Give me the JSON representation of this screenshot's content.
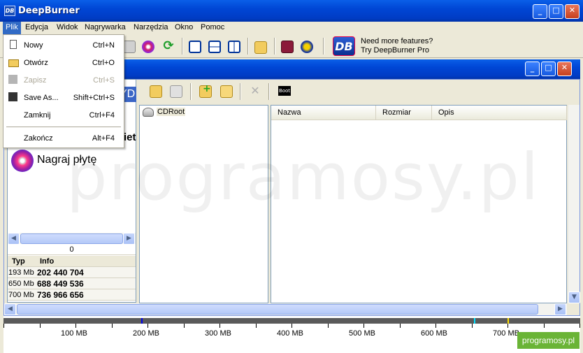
{
  "window": {
    "title": "DeepBurner",
    "icon_text": "DB"
  },
  "menu": [
    "Plik",
    "Edycja",
    "Widok",
    "Nagrywarka",
    "Narzędzia",
    "Okno",
    "Pomoc"
  ],
  "promo": {
    "logo": "DB",
    "line1": "Need more features?",
    "line2": "Try DeepBurner Pro"
  },
  "file_menu": [
    {
      "label": "Nowy",
      "shortcut": "Ctrl+N",
      "icon": "new-file-icon",
      "disabled": false
    },
    {
      "label": "Otwórz",
      "shortcut": "Ctrl+O",
      "icon": "open-folder-icon",
      "disabled": false
    },
    {
      "label": "Zapisz",
      "shortcut": "Ctrl+S",
      "icon": "save-icon",
      "disabled": true
    },
    {
      "label": "Save As...",
      "shortcut": "Shift+Ctrl+S",
      "icon": "save-as-icon",
      "disabled": false
    },
    {
      "label": "Zamknij",
      "shortcut": "Ctrl+F4",
      "icon": "",
      "disabled": false
    },
    {
      "label": "Zakończ",
      "shortcut": "Alt+F4",
      "icon": "",
      "disabled": false
    }
  ],
  "left_panel": {
    "burn_label": "Nagraj płytę",
    "partial_top": "YD",
    "partial_mid": "iet",
    "counter": "0"
  },
  "info": {
    "headers": [
      "Typ",
      "Info"
    ],
    "rows": [
      {
        "type": "193 Mb",
        "info": "202 440 704"
      },
      {
        "type": "650 Mb",
        "info": "688 449 536"
      },
      {
        "type": "700 Mb",
        "info": "736 966 656"
      }
    ]
  },
  "folder_tree": {
    "root": "CDRoot"
  },
  "file_columns": [
    "Nazwa",
    "Rozmiar",
    "Opis"
  ],
  "inner_toolbar": {
    "boot_label": "Boot"
  },
  "ruler": {
    "labels": [
      "100 MB",
      "200 MB",
      "300 MB",
      "400 MB",
      "500 MB",
      "600 MB",
      "700 MB"
    ]
  },
  "watermark": {
    "text": "programosy.pl",
    "badge": "programosy.pl"
  }
}
